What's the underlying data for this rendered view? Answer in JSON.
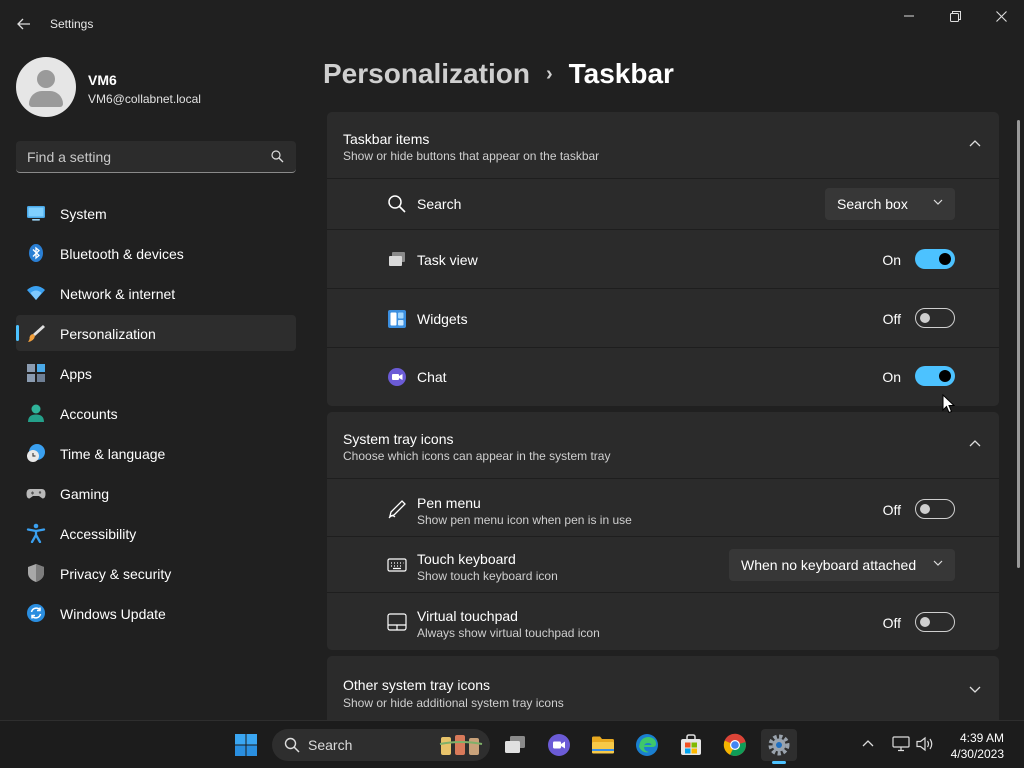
{
  "window": {
    "title": "Settings"
  },
  "account": {
    "name": "VM6",
    "email": "VM6@collabnet.local"
  },
  "search": {
    "placeholder": "Find a setting"
  },
  "sidebar": {
    "items": [
      {
        "label": "System",
        "icon": "system-icon"
      },
      {
        "label": "Bluetooth & devices",
        "icon": "bluetooth-icon"
      },
      {
        "label": "Network & internet",
        "icon": "wifi-icon"
      },
      {
        "label": "Personalization",
        "icon": "brush-icon",
        "active": true
      },
      {
        "label": "Apps",
        "icon": "apps-icon"
      },
      {
        "label": "Accounts",
        "icon": "accounts-icon"
      },
      {
        "label": "Time & language",
        "icon": "clock-globe-icon"
      },
      {
        "label": "Gaming",
        "icon": "gamepad-icon"
      },
      {
        "label": "Accessibility",
        "icon": "accessibility-icon"
      },
      {
        "label": "Privacy & security",
        "icon": "shield-icon"
      },
      {
        "label": "Windows Update",
        "icon": "update-icon"
      }
    ]
  },
  "header": {
    "parent": "Personalization",
    "separator": "›",
    "current": "Taskbar"
  },
  "taskbar_items": {
    "title": "Taskbar items",
    "subtitle": "Show or hide buttons that appear on the taskbar",
    "rows": [
      {
        "label": "Search",
        "icon": "search-icon",
        "value": "Search box"
      },
      {
        "label": "Task view",
        "icon": "task-view-icon",
        "state": "On",
        "on": true
      },
      {
        "label": "Widgets",
        "icon": "widgets-icon",
        "state": "Off",
        "on": false
      },
      {
        "label": "Chat",
        "icon": "chat-icon",
        "state": "On",
        "on": true
      }
    ]
  },
  "system_tray": {
    "title": "System tray icons",
    "subtitle": "Choose which icons can appear in the system tray",
    "rows": [
      {
        "label": "Pen menu",
        "sub": "Show pen menu icon when pen is in use",
        "icon": "pen-icon",
        "state": "Off",
        "on": false
      },
      {
        "label": "Touch keyboard",
        "sub": "Show touch keyboard icon",
        "icon": "keyboard-icon",
        "value": "When no keyboard attached"
      },
      {
        "label": "Virtual touchpad",
        "sub": "Always show virtual touchpad icon",
        "icon": "touchpad-icon",
        "state": "Off",
        "on": false
      }
    ]
  },
  "other_tray": {
    "title": "Other system tray icons",
    "subtitle": "Show or hide additional system tray icons"
  },
  "taskbar": {
    "search_label": "Search",
    "time": "4:39 AM",
    "date": "4/30/2023"
  },
  "colors": {
    "accent": "#4cc2ff",
    "background": "#202020",
    "card": "#2b2b2b"
  }
}
